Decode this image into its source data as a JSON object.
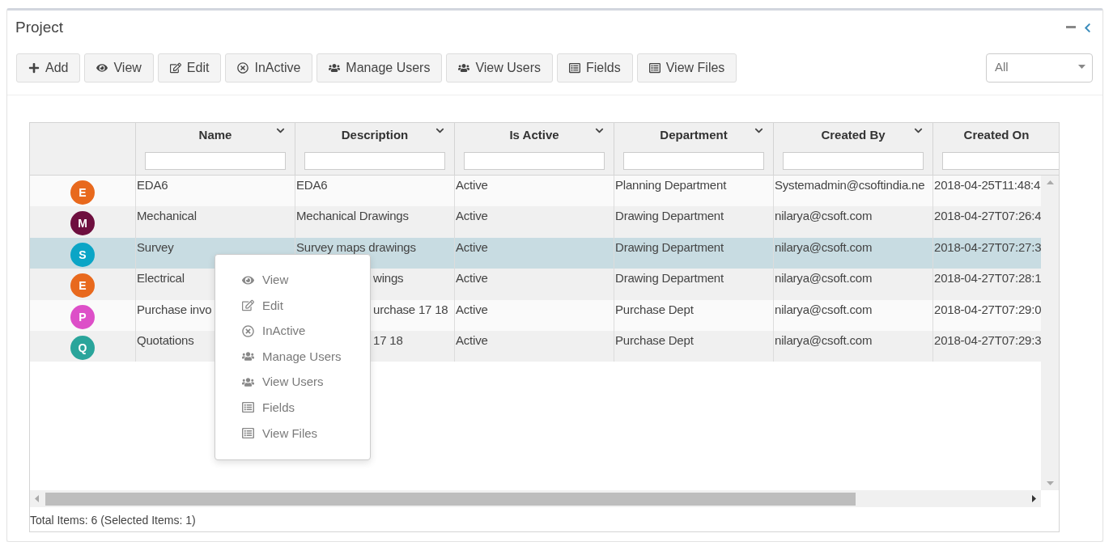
{
  "panel": {
    "title": "Project"
  },
  "toolbar": [
    {
      "label": "Add",
      "kind": "plus"
    },
    {
      "label": "View",
      "kind": "eye"
    },
    {
      "label": "Edit",
      "kind": "edit"
    },
    {
      "label": "InActive",
      "kind": "times-circle"
    },
    {
      "label": "Manage Users",
      "kind": "users"
    },
    {
      "label": "View Users",
      "kind": "users"
    },
    {
      "label": "Fields",
      "kind": "list"
    },
    {
      "label": "View Files",
      "kind": "list"
    }
  ],
  "filter_select": {
    "value": "All"
  },
  "grid": {
    "columns": [
      {
        "label": "Name",
        "menu": true
      },
      {
        "label": "Description",
        "menu": true
      },
      {
        "label": "Is Active",
        "menu": true
      },
      {
        "label": "Department",
        "menu": true
      },
      {
        "label": "Created By",
        "menu": true
      },
      {
        "label": "Created On",
        "menu": false
      }
    ],
    "rows": [
      {
        "avatar": {
          "letter": "E",
          "color": "#e8691d"
        },
        "selected": false,
        "cells": [
          {
            "text": "EDA6"
          },
          {
            "text": "EDA6"
          },
          {
            "text": "Active"
          },
          {
            "text": "Planning Department"
          },
          {
            "text": "Systemadmin@csoftindia.ne"
          },
          {
            "text": "2018-04-25T11:48:4"
          }
        ]
      },
      {
        "avatar": {
          "letter": "M",
          "color": "#6e0f3f"
        },
        "selected": false,
        "cells": [
          {
            "text": "Mechanical"
          },
          {
            "text": "Mechanical Drawings"
          },
          {
            "text": "Active"
          },
          {
            "text": "Drawing Department"
          },
          {
            "text": "nilarya@csoft.com"
          },
          {
            "text": "2018-04-27T07:26:4"
          }
        ]
      },
      {
        "avatar": {
          "letter": "S",
          "color": "#0ba5c6"
        },
        "selected": true,
        "cells": [
          {
            "text": "Survey"
          },
          {
            "text": "Survey maps drawings"
          },
          {
            "text": "Active"
          },
          {
            "text": "Drawing Department"
          },
          {
            "text": "nilarya@csoft.com"
          },
          {
            "text": "2018-04-27T07:27:3"
          }
        ]
      },
      {
        "avatar": {
          "letter": "E",
          "color": "#e8691d"
        },
        "selected": false,
        "cells": [
          {
            "text": "Electrical"
          },
          {
            "text": "wings",
            "kind": "covered"
          },
          {
            "text": "Active"
          },
          {
            "text": "Drawing Department"
          },
          {
            "text": "nilarya@csoft.com"
          },
          {
            "text": "2018-04-27T07:28:1"
          }
        ]
      },
      {
        "avatar": {
          "letter": "P",
          "color": "#dd4fc8"
        },
        "selected": false,
        "cells": [
          {
            "text": "Purchase invo"
          },
          {
            "text": "urchase 17 18",
            "kind": "covered"
          },
          {
            "text": "Active"
          },
          {
            "text": "Purchase Dept"
          },
          {
            "text": "nilarya@csoft.com"
          },
          {
            "text": "2018-04-27T07:29:0"
          }
        ]
      },
      {
        "avatar": {
          "letter": "Q",
          "color": "#2aa59b"
        },
        "selected": false,
        "cells": [
          {
            "text": "Quotations"
          },
          {
            "text": "17 18",
            "kind": "covered"
          },
          {
            "text": "Active"
          },
          {
            "text": "Purchase Dept"
          },
          {
            "text": "nilarya@csoft.com"
          },
          {
            "text": "2018-04-27T07:29:3"
          }
        ]
      }
    ],
    "footer": "Total Items: 6 (Selected Items: 1)"
  },
  "context_menu": [
    {
      "label": "View",
      "kind": "eye"
    },
    {
      "label": "Edit",
      "kind": "edit"
    },
    {
      "label": "InActive",
      "kind": "times-circle"
    },
    {
      "label": "Manage Users",
      "kind": "users"
    },
    {
      "label": "View Users",
      "kind": "users"
    },
    {
      "label": "Fields",
      "kind": "list"
    },
    {
      "label": "View Files",
      "kind": "list"
    }
  ]
}
